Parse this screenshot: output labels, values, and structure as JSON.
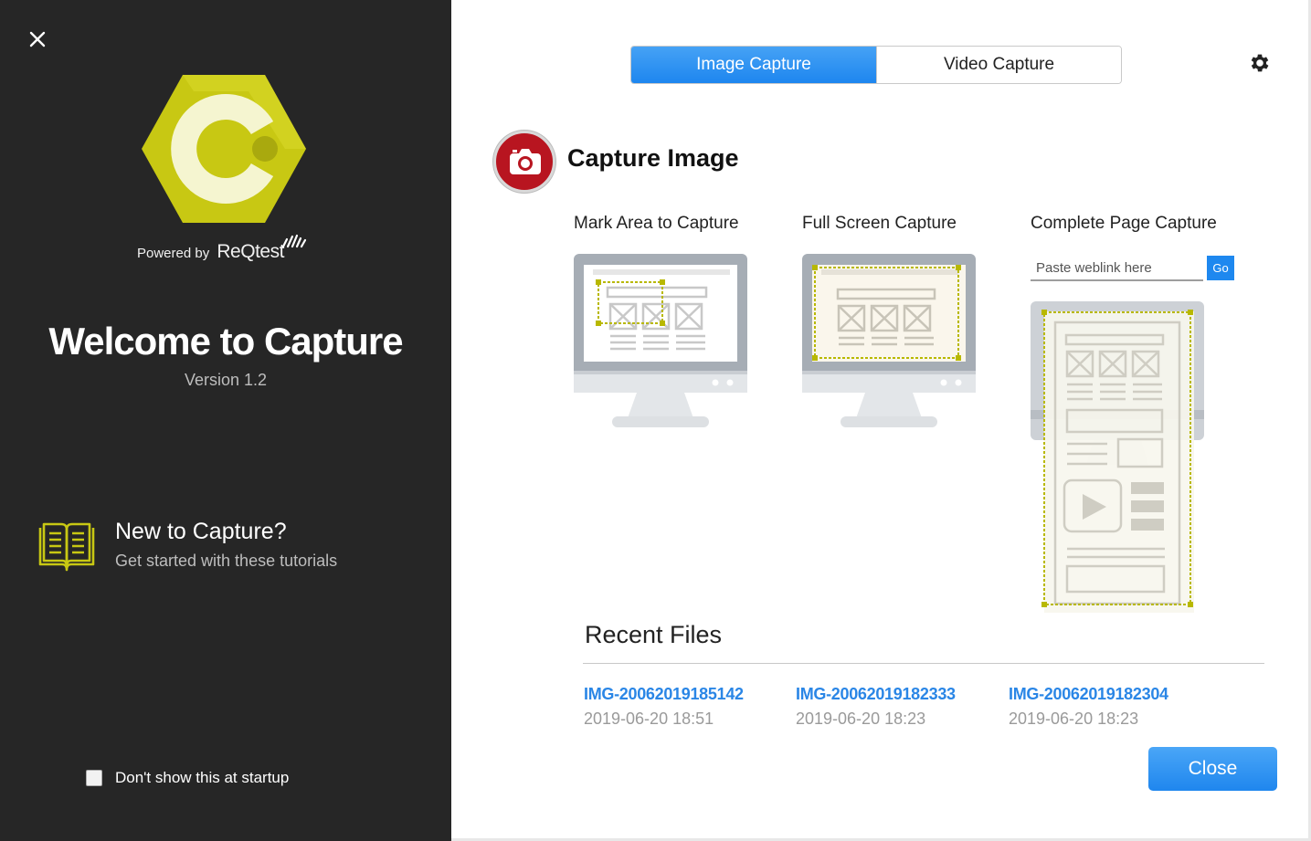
{
  "left": {
    "powered_prefix": "Powered by",
    "powered_brand": "ReQtest",
    "welcome_title": "Welcome to Capture",
    "version": "Version 1.2",
    "tutorial_title": "New to Capture?",
    "tutorial_subtitle": "Get started with these tutorials",
    "startup_label": "Don't show this at startup",
    "startup_checked": false
  },
  "tabs": [
    {
      "label": "Image Capture",
      "active": true
    },
    {
      "label": "Video Capture",
      "active": false
    }
  ],
  "capture": {
    "title": "Capture Image",
    "options": [
      {
        "label": "Mark Area to Capture"
      },
      {
        "label": "Full Screen Capture"
      },
      {
        "label": "Complete Page Capture"
      }
    ],
    "url_placeholder": "Paste weblink here",
    "url_value": "",
    "go_label": "Go"
  },
  "recent": {
    "title": "Recent Files",
    "files": [
      {
        "name": "IMG-20062019185142",
        "date": "2019-06-20 18:51"
      },
      {
        "name": "IMG-20062019182333",
        "date": "2019-06-20 18:23"
      },
      {
        "name": "IMG-20062019182304",
        "date": "2019-06-20 18:23"
      }
    ]
  },
  "close_label": "Close",
  "icons": {
    "close": "close-icon",
    "settings": "gear-icon",
    "camera": "camera-icon",
    "tutorials": "book-icon",
    "logo": "capture-logo"
  },
  "colors": {
    "left_bg": "#262626",
    "accent_blue": "#1e86ef",
    "logo_yellow": "#c8c813",
    "camera_red": "#b81520",
    "selection_yellow": "#b8b800"
  }
}
